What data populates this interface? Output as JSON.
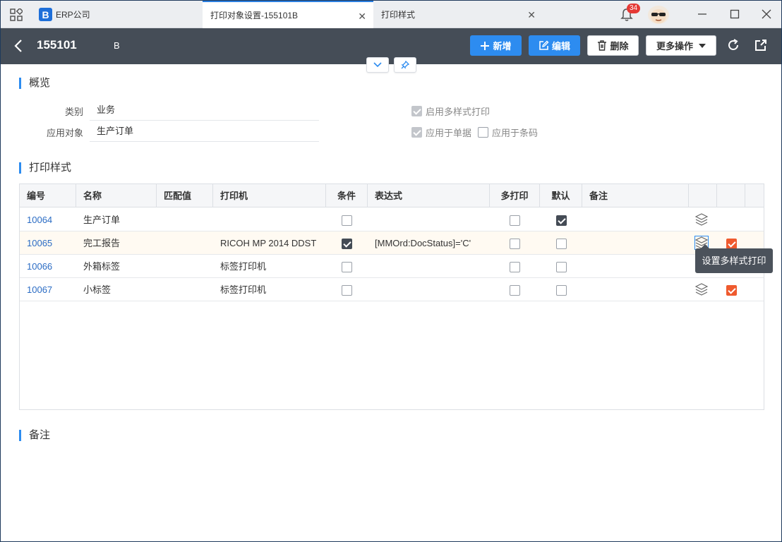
{
  "app": {
    "name": "ERP公司",
    "logo_letter": "B"
  },
  "tabs": [
    {
      "label": "打印对象设置-155101B",
      "active": true
    },
    {
      "label": "打印样式",
      "active": false
    }
  ],
  "notifications": {
    "count": "34"
  },
  "header": {
    "doc_no": "155101",
    "doc_suffix": "B",
    "buttons": {
      "add": "新增",
      "edit": "编辑",
      "delete": "删除",
      "more": "更多操作"
    }
  },
  "overview": {
    "title": "概览",
    "category_label": "类别",
    "category_value": "业务",
    "target_label": "应用对象",
    "target_value": "生产订单",
    "multi_style_label": "启用多样式打印",
    "apply_doc_label": "应用于单据",
    "apply_barcode_label": "应用于条码"
  },
  "print_styles": {
    "title": "打印样式",
    "columns": [
      "编号",
      "名称",
      "匹配值",
      "打印机",
      "条件",
      "表达式",
      "多打印",
      "默认",
      "备注"
    ],
    "rows": [
      {
        "id": "10064",
        "name": "生产订单",
        "match": "",
        "printer": "",
        "condition": false,
        "expr": "",
        "multi": false,
        "default": true,
        "note": "",
        "layers": true,
        "active": false
      },
      {
        "id": "10065",
        "name": "完工报告",
        "match": "",
        "printer": "RICOH MP 2014 DDST",
        "condition": true,
        "expr": "[MMOrd:DocStatus]='C'",
        "multi": false,
        "default": false,
        "note": "",
        "layers": true,
        "active": true
      },
      {
        "id": "10066",
        "name": "外箱标签",
        "match": "",
        "printer": "标签打印机",
        "condition": false,
        "expr": "",
        "multi": false,
        "default": false,
        "note": "",
        "layers": false,
        "active": false
      },
      {
        "id": "10067",
        "name": "小标签",
        "match": "",
        "printer": "标签打印机",
        "condition": false,
        "expr": "",
        "multi": false,
        "default": false,
        "note": "",
        "layers": true,
        "active": true
      }
    ]
  },
  "tooltip": "设置多样式打印",
  "notes": {
    "title": "备注"
  },
  "colors": {
    "accent": "#2d8cf0",
    "header_bg": "#454d57",
    "active_orange": "#ef5a2e"
  }
}
